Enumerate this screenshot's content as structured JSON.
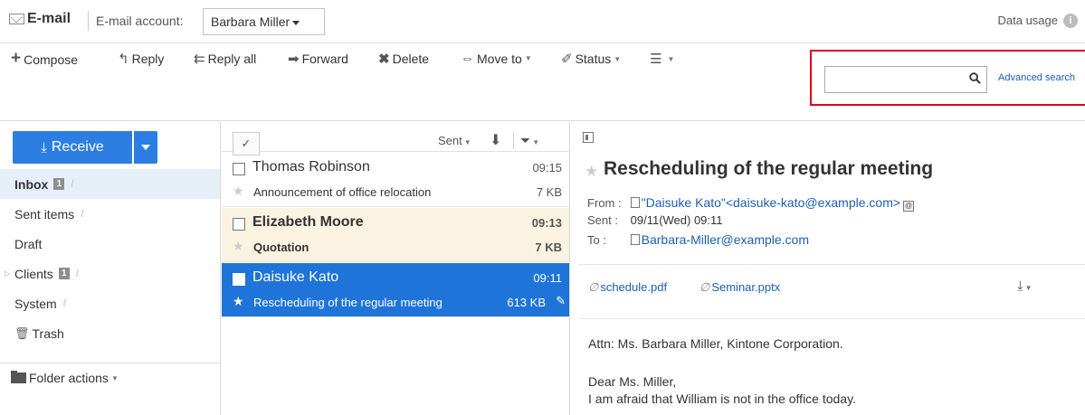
{
  "app": {
    "title": "E-mail"
  },
  "header": {
    "account_label": "E-mail account:",
    "account_value": "Barbara Miller",
    "data_usage": "Data usage"
  },
  "toolbar": {
    "compose": "Compose",
    "reply": "Reply",
    "reply_all": "Reply all",
    "forward": "Forward",
    "delete": "Delete",
    "move_to": "Move to",
    "status": "Status",
    "search_placeholder": "",
    "advanced_search": "Advanced search"
  },
  "sidebar": {
    "receive_label": "Receive",
    "folders": [
      {
        "label": "Inbox",
        "badge": "1",
        "active": true
      },
      {
        "label": "Sent items"
      },
      {
        "label": "Draft"
      },
      {
        "label": "Clients",
        "badge": "1"
      },
      {
        "label": "System"
      },
      {
        "label": "Trash"
      }
    ],
    "folder_actions": "Folder actions"
  },
  "list": {
    "sort_label": "Sent",
    "select_all_glyph": "✓",
    "rows": [
      {
        "sender": "Thomas Robinson",
        "time": "09:15",
        "subject": "Announcement of office relocation",
        "size": "7 KB",
        "state": "read"
      },
      {
        "sender": "Elizabeth Moore",
        "time": "09:13",
        "subject": "Quotation",
        "size": "7 KB",
        "state": "unread"
      },
      {
        "sender": "Daisuke Kato",
        "time": "09:11",
        "subject": "Rescheduling of the regular meeting",
        "size": "613 KB",
        "state": "selected"
      }
    ]
  },
  "message": {
    "subject": "Rescheduling of the regular meeting",
    "from_label": "From",
    "from_value": "\"Daisuke Kato\"<daisuke-kato@example.com>",
    "sent_label": "Sent",
    "sent_value": "09/11(Wed) 09:11",
    "to_label": "To",
    "to_value": "Barbara-Miller@example.com",
    "attachments": [
      "schedule.pdf",
      "Seminar.pptx"
    ],
    "body": [
      "Attn: Ms. Barbara Miller, Kintone Corporation.",
      "Dear Ms. Miller,",
      "I am afraid that William is not in the office today."
    ]
  },
  "colors": {
    "accent_blue": "#2d7ee3",
    "selected_row": "#1e74d8",
    "unread_row": "#fbf3e1",
    "highlight_frame": "#e0001b",
    "link": "#1c5fb0"
  }
}
